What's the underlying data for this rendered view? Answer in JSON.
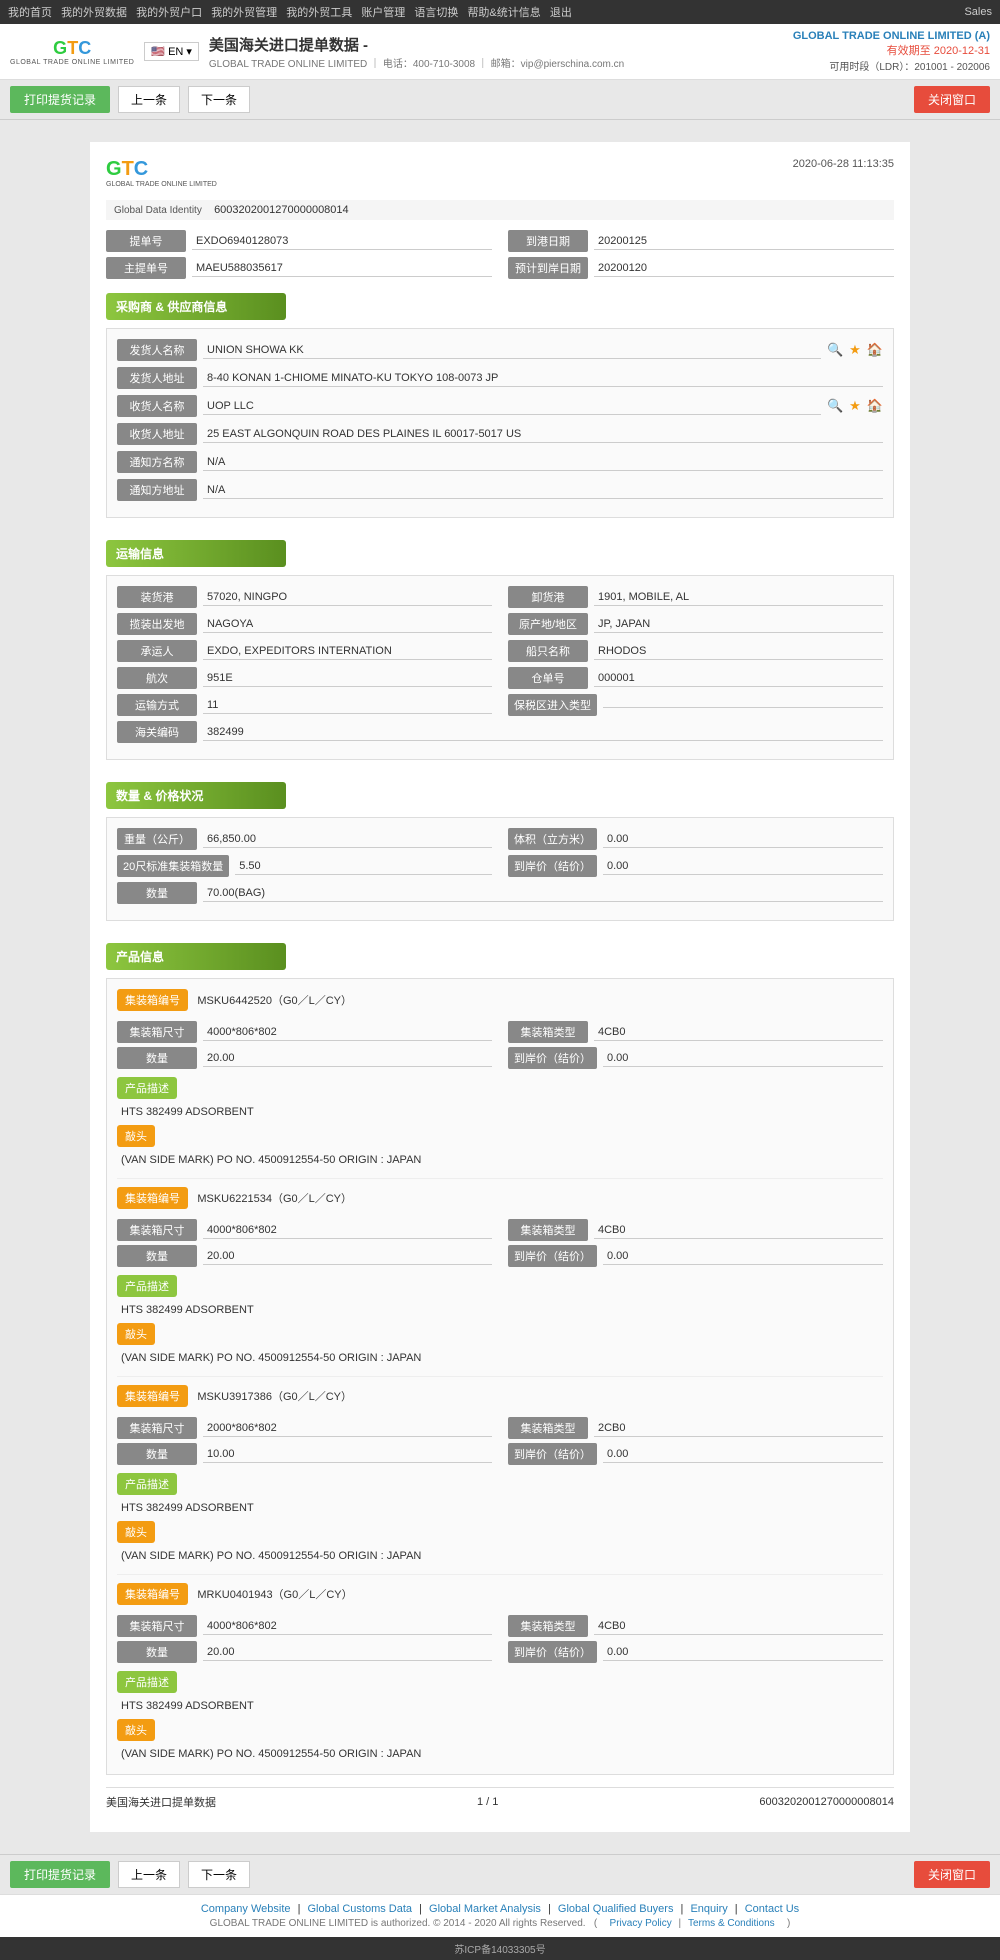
{
  "topNav": {
    "links": [
      "我的首页",
      "我的外贸数据",
      "我的外贸户口",
      "我的外贸管理",
      "我的外贸工具",
      "账户管理",
      "语言切换",
      "帮助&统计信息",
      "退出"
    ],
    "sales": "Sales"
  },
  "header": {
    "logoLetters": "GTC",
    "logoSub": "GLOBAL TRADE ONLINE LIMITED",
    "flagLabel": "EN",
    "pageTitle": "美国海关进口提单数据 -",
    "contactPhone": "400-710-3008",
    "contactEmail": "vip@pierschina.com.cn",
    "companyName": "GLOBAL TRADE ONLINE LIMITED (A)",
    "validity": "有效期至 2020-12-31",
    "ldr": "可用时段（LDR）：201001 - 202006"
  },
  "toolbar": {
    "printLabel": "打印提货记录",
    "prevLabel": "上一条",
    "nextLabel": "下一条",
    "closeLabel": "关闭窗口"
  },
  "document": {
    "datetime": "2020-06-28 11:13:35",
    "globalDataIdentity": {
      "label": "Global Data Identity",
      "value": "6003202001270000008014"
    },
    "fields": {
      "billNo": {
        "label": "提单号",
        "value": "EXDO6940128073"
      },
      "arrivalDate": {
        "label": "到港日期",
        "value": "20200125"
      },
      "masterNo": {
        "label": "主提单号",
        "value": "MAEU588035617"
      },
      "estimatedDate": {
        "label": "预计到岸日期",
        "value": "20200120"
      }
    }
  },
  "senderReceiver": {
    "sectionTitle": "采购商 & 供应商信息",
    "senderName": {
      "label": "发货人名称",
      "value": "UNION SHOWA KK"
    },
    "senderAddress": {
      "label": "发货人地址",
      "value": "8-40 KONAN 1-CHIOME MINATO-KU TOKYO 108-0073 JP"
    },
    "receiverName": {
      "label": "收货人名称",
      "value": "UOP LLC"
    },
    "receiverAddress": {
      "label": "收货人地址",
      "value": "25 EAST ALGONQUIN ROAD DES PLAINES IL 60017-5017 US"
    },
    "notifyName": {
      "label": "通知方名称",
      "value": "N/A"
    },
    "notifyAddress": {
      "label": "通知方地址",
      "value": "N/A"
    }
  },
  "logistics": {
    "sectionTitle": "运输信息",
    "loadPort": {
      "label": "装货港",
      "value": "57020, NINGPO"
    },
    "dischargePort": {
      "label": "卸货港",
      "value": "1901, MOBILE, AL"
    },
    "originPlace": {
      "label": "揽装出发地",
      "value": "NAGOYA"
    },
    "originCountry": {
      "label": "原产地/地区",
      "value": "JP, JAPAN"
    },
    "forwarder": {
      "label": "承运人",
      "value": "EXDO, EXPEDITORS INTERNATION"
    },
    "vesselName": {
      "label": "船只名称",
      "value": "RHODOS"
    },
    "voyage": {
      "label": "航次",
      "value": "951E"
    },
    "billSeq": {
      "label": "仓单号",
      "value": "000001"
    },
    "transportMode": {
      "label": "运输方式",
      "value": "11"
    },
    "customsZone": {
      "label": "保税区进入类型",
      "value": ""
    },
    "customsNum": {
      "label": "海关编码",
      "value": "382499"
    }
  },
  "weightPrice": {
    "sectionTitle": "数量 & 价格状况",
    "weight": {
      "label": "重量（公斤）",
      "value": "66,850.00"
    },
    "volume": {
      "label": "体积（立方米）",
      "value": "0.00"
    },
    "containers20": {
      "label": "20尺标准集装箱数量",
      "value": "5.50"
    },
    "unitPrice": {
      "label": "到岸价（结价）",
      "value": "0.00"
    },
    "quantity": {
      "label": "数量",
      "value": "70.00(BAG)"
    }
  },
  "productInfo": {
    "sectionTitle": "产品信息",
    "products": [
      {
        "containerNo": "MSKU6442520（G0／L／CY）",
        "containerNoLabel": "集装箱编号",
        "containerSize": {
          "label": "集装箱尺寸",
          "value": "4000*806*802"
        },
        "containerType": {
          "label": "集装箱类型",
          "value": "4CB0"
        },
        "quantity": {
          "label": "数量",
          "value": "20.00"
        },
        "unitPrice": {
          "label": "到岸价（结价）",
          "value": "0.00"
        },
        "descLabel": "产品描述",
        "desc": "HTS 382499 ADSORBENT",
        "marksLabel": "敲头",
        "marks": "(VAN SIDE MARK) PO NO. 4500912554-50 ORIGIN : JAPAN"
      },
      {
        "containerNo": "MSKU6221534（G0／L／CY）",
        "containerNoLabel": "集装箱编号",
        "containerSize": {
          "label": "集装箱尺寸",
          "value": "4000*806*802"
        },
        "containerType": {
          "label": "集装箱类型",
          "value": "4CB0"
        },
        "quantity": {
          "label": "数量",
          "value": "20.00"
        },
        "unitPrice": {
          "label": "到岸价（结价）",
          "value": "0.00"
        },
        "descLabel": "产品描述",
        "desc": "HTS 382499 ADSORBENT",
        "marksLabel": "敲头",
        "marks": "(VAN SIDE MARK) PO NO. 4500912554-50 ORIGIN : JAPAN"
      },
      {
        "containerNo": "MSKU3917386（G0／L／CY）",
        "containerNoLabel": "集装箱编号",
        "containerSize": {
          "label": "集装箱尺寸",
          "value": "2000*806*802"
        },
        "containerType": {
          "label": "集装箱类型",
          "value": "2CB0"
        },
        "quantity": {
          "label": "数量",
          "value": "10.00"
        },
        "unitPrice": {
          "label": "到岸价（结价）",
          "value": "0.00"
        },
        "descLabel": "产品描述",
        "desc": "HTS 382499 ADSORBENT",
        "marksLabel": "敲头",
        "marks": "(VAN SIDE MARK) PO NO. 4500912554-50 ORIGIN : JAPAN"
      },
      {
        "containerNo": "MRKU0401943（G0／L／CY）",
        "containerNoLabel": "集装箱编号",
        "containerSize": {
          "label": "集装箱尺寸",
          "value": "4000*806*802"
        },
        "containerType": {
          "label": "集装箱类型",
          "value": "4CB0"
        },
        "quantity": {
          "label": "数量",
          "value": "20.00"
        },
        "unitPrice": {
          "label": "到岸价（结价）",
          "value": "0.00"
        },
        "descLabel": "产品描述",
        "desc": "HTS 382499 ADSORBENT",
        "marksLabel": "敲头",
        "marks": "(VAN SIDE MARK) PO NO. 4500912554-50 ORIGIN : JAPAN"
      }
    ]
  },
  "docFooter": {
    "leftLabel": "美国海关进口提单数据",
    "pageInfo": "1 / 1",
    "globalId": "6003202001270000008014"
  },
  "bottomToolbar": {
    "printLabel": "打印提货记录",
    "prevLabel": "上一条",
    "nextLabel": "下一条",
    "closeLabel": "关闭窗口"
  },
  "footer": {
    "links": [
      "Company Website",
      "Global Customs Data",
      "Global Market Analysis",
      "Global Qualified Buyers",
      "Enquiry",
      "Contact Us"
    ],
    "copyright": "GLOBAL TRADE ONLINE LIMITED is authorized. © 2014 - 2020 All rights Reserved.",
    "privacyPolicy": "Privacy Policy",
    "termsConditions": "Terms & Conditions",
    "icp": "苏ICP备14033305号"
  }
}
